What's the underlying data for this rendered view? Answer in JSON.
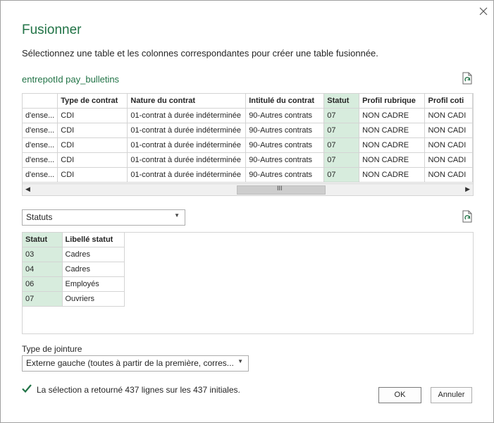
{
  "dialog": {
    "title": "Fusionner",
    "description": "Sélectionnez une table et les colonnes correspondantes pour créer une table fusionnée.",
    "close_icon": "close-icon"
  },
  "table1": {
    "name": "entrepotId pay_bulletins",
    "columns": [
      "",
      "Type de contrat",
      "Nature du contrat",
      "Intitulé du contrat",
      "Statut",
      "Profil rubrique",
      "Profil coti"
    ],
    "rows": [
      [
        "d'ense...",
        "CDI",
        "01-contrat à durée indéterminée",
        "90-Autres contrats",
        "07",
        "NON CADRE",
        "NON CADI"
      ],
      [
        "d'ense...",
        "CDI",
        "01-contrat à durée indéterminée",
        "90-Autres contrats",
        "07",
        "NON CADRE",
        "NON CADI"
      ],
      [
        "d'ense...",
        "CDI",
        "01-contrat à durée indéterminée",
        "90-Autres contrats",
        "07",
        "NON CADRE",
        "NON CADI"
      ],
      [
        "d'ense...",
        "CDI",
        "01-contrat à durée indéterminée",
        "90-Autres contrats",
        "07",
        "NON CADRE",
        "NON CADI"
      ],
      [
        "d'ense...",
        "CDI",
        "01-contrat à durée indéterminée",
        "90-Autres contrats",
        "07",
        "NON CADRE",
        "NON CADI"
      ]
    ],
    "scroll_thumb": "III"
  },
  "table2": {
    "selected": "Statuts",
    "columns": [
      "Statut",
      "Libellé statut"
    ],
    "rows": [
      [
        "03",
        "Cadres"
      ],
      [
        "04",
        "Cadres"
      ],
      [
        "06",
        "Employés"
      ],
      [
        "07",
        "Ouvriers"
      ]
    ]
  },
  "join": {
    "label": "Type de jointure",
    "value": "Externe gauche (toutes à partir de la première, corres..."
  },
  "status_text": "La sélection a retourné 437 lignes sur les 437 initiales.",
  "buttons": {
    "ok": "OK",
    "cancel": "Annuler"
  },
  "colors": {
    "accent": "#217346",
    "selected_column": "#d7ecdd"
  }
}
